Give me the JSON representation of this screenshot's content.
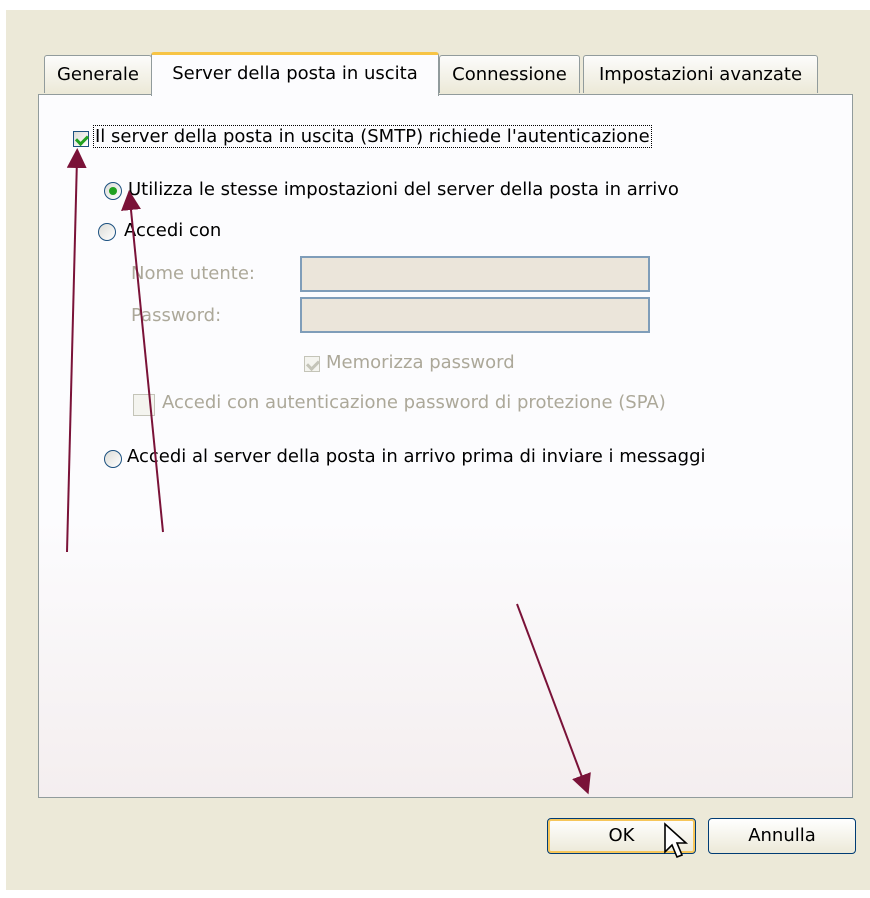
{
  "tabs": [
    {
      "label": "Generale",
      "active": false
    },
    {
      "label": "Server della posta in uscita",
      "active": true
    },
    {
      "label": "Connessione",
      "active": false
    },
    {
      "label": "Impostazioni avanzate",
      "active": false
    }
  ],
  "smtp_auth": {
    "label": "Il server della posta in uscita (SMTP) richiede l'autenticazione",
    "checked": true
  },
  "radio_same": {
    "label": "Utilizza le stesse impostazioni del server della posta in arrivo",
    "checked": true
  },
  "radio_login": {
    "label": "Accedi con",
    "checked": false
  },
  "username": {
    "label": "Nome utente:",
    "value": ""
  },
  "password": {
    "label": "Password:",
    "value": ""
  },
  "remember_password": {
    "label": "Memorizza password",
    "checked": true
  },
  "spa": {
    "label": "Accedi con autenticazione password di protezione (SPA)",
    "checked": false
  },
  "radio_incoming_first": {
    "label": "Accedi al server della posta in arrivo prima di inviare i messaggi",
    "checked": false
  },
  "buttons": {
    "ok": "OK",
    "cancel": "Annulla"
  },
  "colors": {
    "annotation_arrow": "#7a1238",
    "checkmark": "#21a121",
    "active_tab_accent": "#f7c445"
  }
}
